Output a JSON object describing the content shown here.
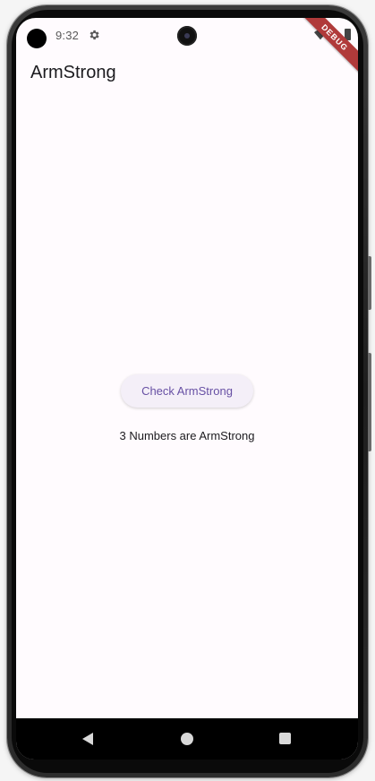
{
  "status_bar": {
    "time": "9:32",
    "gear_icon": "gear-icon",
    "wifi_icon": "wifi-icon",
    "battery_icon": "battery-icon"
  },
  "debug_banner": {
    "label": "DEBUG",
    "color": "#b03a3a"
  },
  "app_bar": {
    "title": "ArmStrong"
  },
  "main": {
    "button_label": "Check ArmStrong",
    "result_text": "3 Numbers are ArmStrong"
  },
  "nav_bar": {
    "back_icon": "back-triangle-icon",
    "home_icon": "home-circle-icon",
    "recents_icon": "recents-square-icon"
  },
  "colors": {
    "background": "#fffbfe",
    "primary": "#6750a4",
    "button_surface": "#f4eff8",
    "text": "#1c1b1f"
  }
}
